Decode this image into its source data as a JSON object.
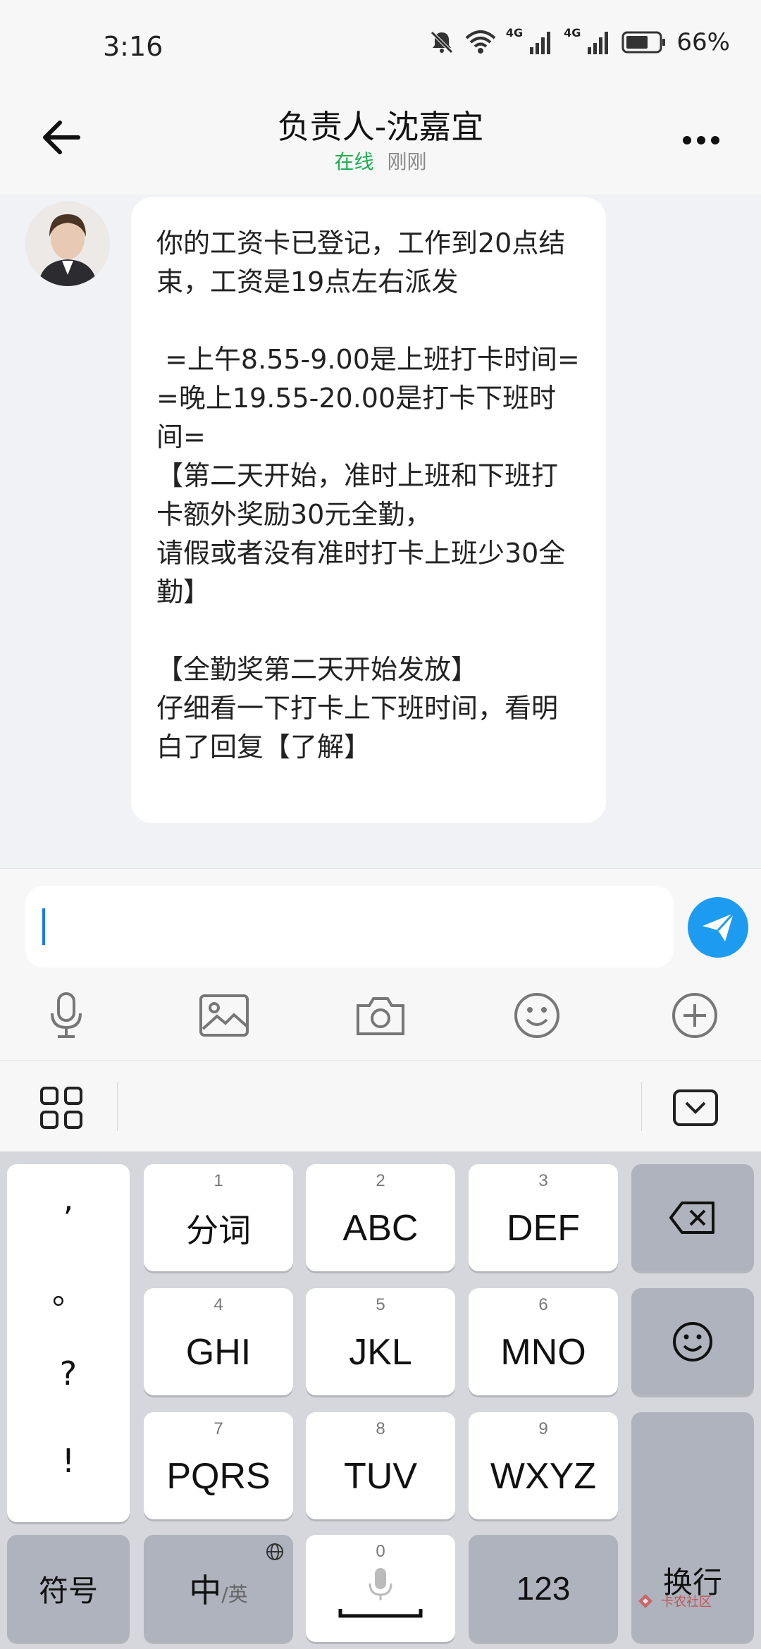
{
  "status_bar": {
    "time": "3:16",
    "signal_1_label": "4G",
    "signal_2_label": "4G",
    "battery_percent": "66%"
  },
  "header": {
    "title": "负责人-沈嘉宜",
    "online_status": "在线",
    "last_seen": "刚刚"
  },
  "message": {
    "text": "你的工资卡已登记，工作到20点结束，工资是19点左右派发\n\n =上午8.55-9.00是上班打卡时间=\n=晚上19.55-20.00是打卡下班时间=\n【第二天开始，准时上班和下班打卡额外奖励30元全勤，\n请假或者没有准时打卡上班少30全勤】\n\n【全勤奖第二天开始发放】\n仔细看一下打卡上下班时间，看明白了回复【了解】"
  },
  "input": {
    "value": ""
  },
  "keyboard": {
    "punctuation": [
      ",",
      "。",
      "?",
      "!"
    ],
    "row1": [
      {
        "num": "1",
        "label": "分词"
      },
      {
        "num": "2",
        "label": "ABC"
      },
      {
        "num": "3",
        "label": "DEF"
      }
    ],
    "row2": [
      {
        "num": "4",
        "label": "GHI"
      },
      {
        "num": "5",
        "label": "JKL"
      },
      {
        "num": "6",
        "label": "MNO"
      }
    ],
    "row3": [
      {
        "num": "7",
        "label": "PQRS"
      },
      {
        "num": "8",
        "label": "TUV"
      },
      {
        "num": "9",
        "label": "WXYZ"
      }
    ],
    "symbols_label": "符号",
    "lang_main": "中",
    "lang_alt": "/英",
    "space_num": "0",
    "numbers_label": "123",
    "enter_label": "换行"
  },
  "watermark": {
    "text": "卡农社区"
  },
  "colors": {
    "online_green": "#1fae52",
    "send_blue": "#1d9bf0",
    "caret_blue": "#1677ff"
  }
}
